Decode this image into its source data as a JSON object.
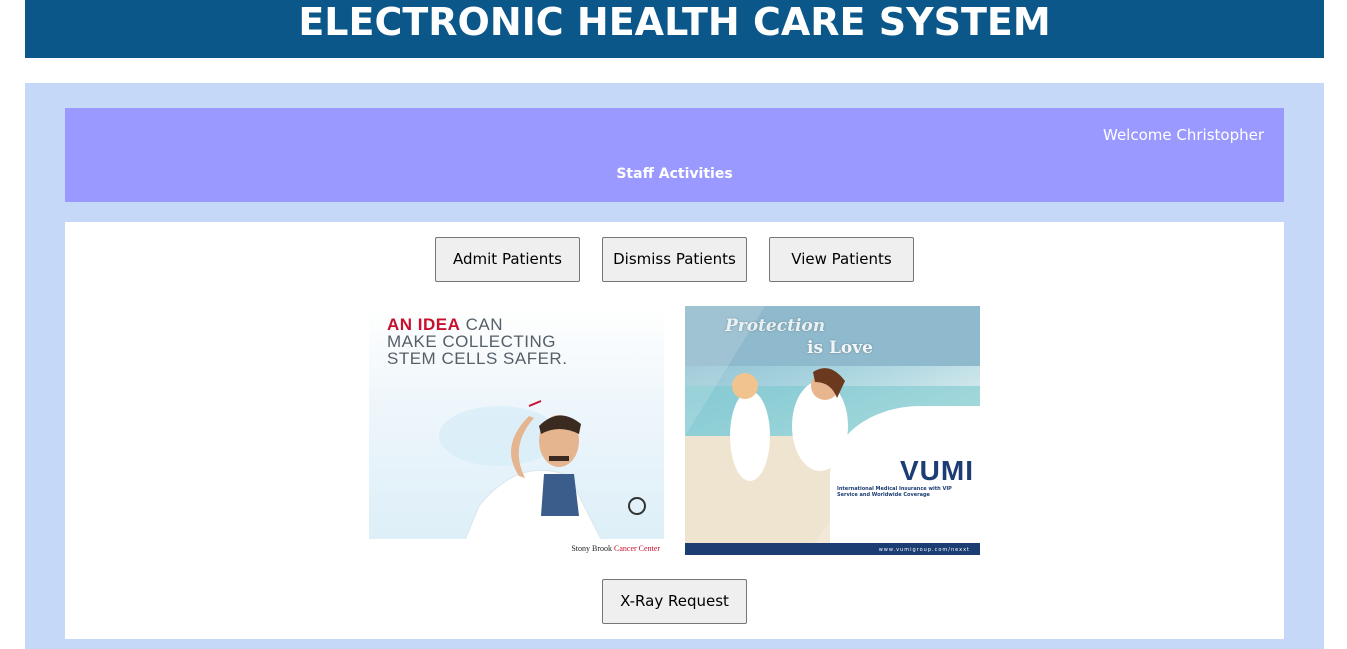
{
  "header": {
    "title": "ELECTRONIC HEALTH CARE SYSTEM"
  },
  "panel": {
    "welcome": "Welcome Christopher",
    "section_title": "Staff Activities"
  },
  "buttons": {
    "admit": "Admit Patients",
    "dismiss": "Dismiss Patients",
    "view": "View Patients",
    "xray": "X-Ray Request"
  },
  "ads": {
    "left": {
      "headline_red": "AN IDEA",
      "headline_rest_1": " CAN",
      "headline_line2": "MAKE COLLECTING",
      "headline_line3": "STEM CELLS SAFER.",
      "brand_black": "Stony Brook ",
      "brand_red": "Cancer Center"
    },
    "right": {
      "protection": "Protection",
      "is_love": "is Love",
      "logo": "VUMI",
      "subtitle": "International Medical Insurance with VIP Service and Worldwide Coverage",
      "url": "www.vumigroup.com/nexxt"
    }
  },
  "colors": {
    "title_bg": "#0b5789",
    "outer_bg": "#c6d8f7",
    "header_bg": "#9999ff"
  }
}
